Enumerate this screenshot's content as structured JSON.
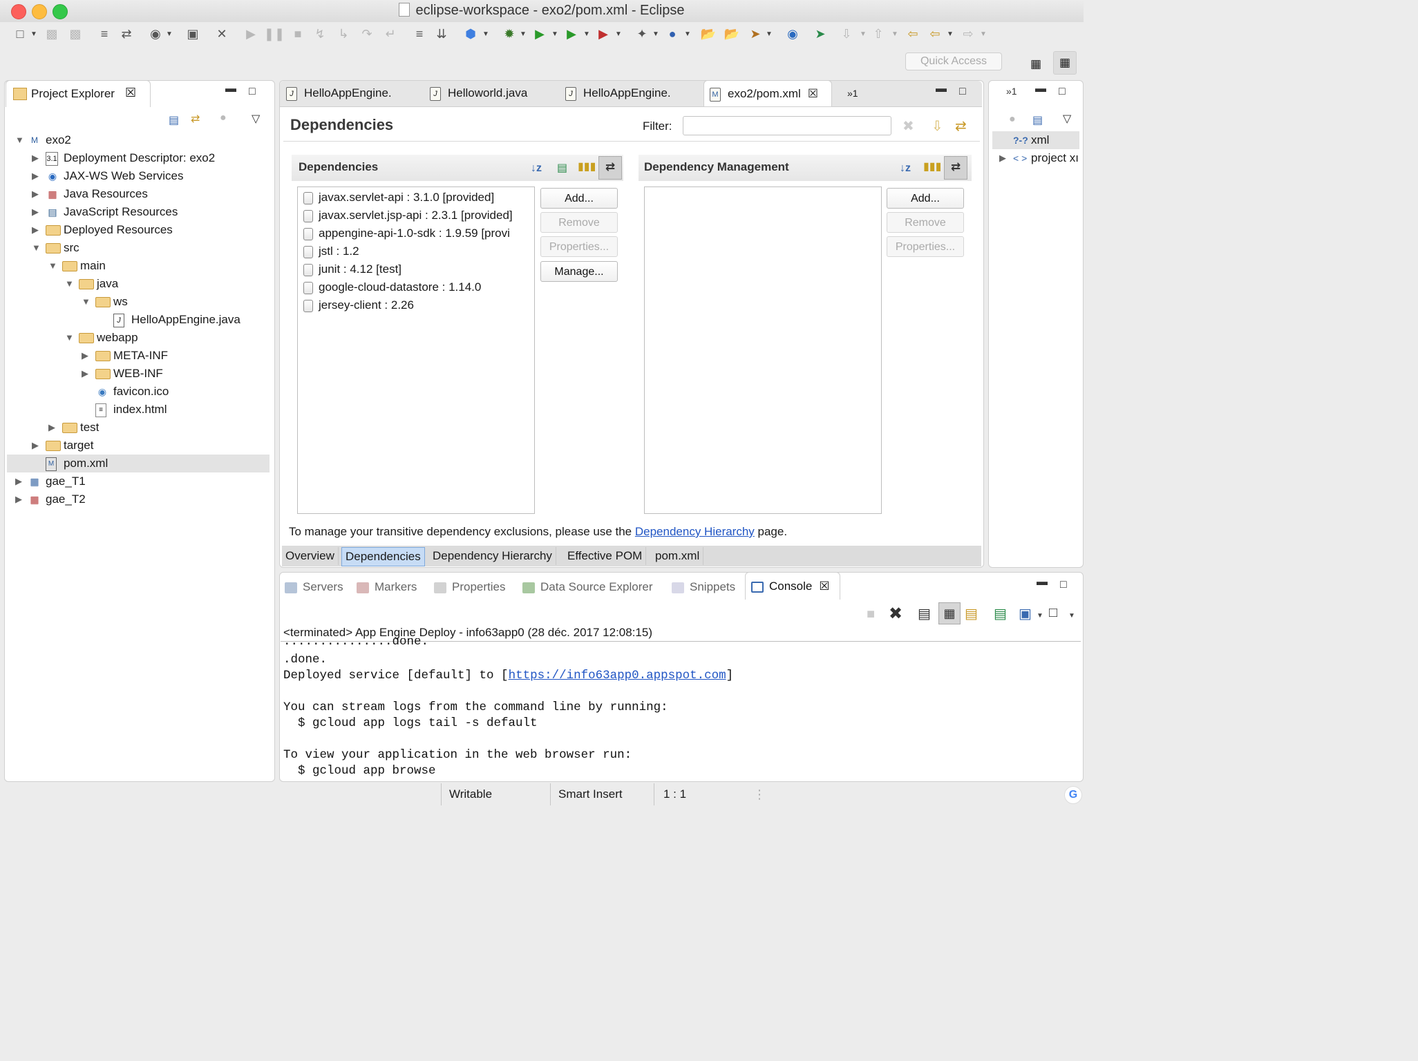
{
  "window": {
    "title": "eclipse-workspace - exo2/pom.xml - Eclipse",
    "colors": {
      "close": "#fc605b",
      "minimize": "#fdbc40",
      "zoom": "#34c84a"
    }
  },
  "toolbar": {
    "quick_access_placeholder": "Quick Access"
  },
  "project_explorer": {
    "tab_label": "Project Explorer",
    "tree": [
      {
        "label": "exo2",
        "icon": "maven-project-icon",
        "expanded": true
      },
      {
        "label": "Deployment Descriptor: exo2",
        "icon": "deployment-descriptor-icon"
      },
      {
        "label": "JAX-WS Web Services",
        "icon": "web-services-icon"
      },
      {
        "label": "Java Resources",
        "icon": "java-resources-icon"
      },
      {
        "label": "JavaScript Resources",
        "icon": "javascript-resources-icon"
      },
      {
        "label": "Deployed Resources",
        "icon": "folder-icon"
      },
      {
        "label": "src",
        "icon": "folder-icon",
        "expanded": true
      },
      {
        "label": "main",
        "icon": "folder-icon",
        "expanded": true
      },
      {
        "label": "java",
        "icon": "folder-icon",
        "expanded": true
      },
      {
        "label": "ws",
        "icon": "folder-icon",
        "expanded": true
      },
      {
        "label": "HelloAppEngine.java",
        "icon": "java-file-icon"
      },
      {
        "label": "webapp",
        "icon": "folder-icon",
        "expanded": true
      },
      {
        "label": "META-INF",
        "icon": "folder-icon"
      },
      {
        "label": "WEB-INF",
        "icon": "folder-icon"
      },
      {
        "label": "favicon.ico",
        "icon": "globe-icon"
      },
      {
        "label": "index.html",
        "icon": "html-file-icon"
      },
      {
        "label": "test",
        "icon": "folder-icon"
      },
      {
        "label": "target",
        "icon": "folder-icon"
      },
      {
        "label": "pom.xml",
        "icon": "pom-file-icon",
        "selected": true
      },
      {
        "label": "gae_T1",
        "icon": "java-project-icon"
      },
      {
        "label": "gae_T2",
        "icon": "java-project-icon"
      }
    ]
  },
  "editor": {
    "tabs": [
      {
        "label": "HelloAppEngine.",
        "icon": "java-file-icon"
      },
      {
        "label": "Helloworld.java",
        "icon": "java-file-icon"
      },
      {
        "label": "HelloAppEngine.",
        "icon": "java-file-icon"
      },
      {
        "label": "exo2/pom.xml",
        "icon": "pom-file-icon",
        "active": true
      }
    ],
    "overflow_label": "»1",
    "page_title": "Dependencies",
    "filter_label": "Filter:",
    "filter_value": "",
    "dependencies": {
      "header": "Dependencies",
      "items": [
        "javax.servlet-api : 3.1.0 [provided]",
        "javax.servlet.jsp-api : 2.3.1 [provided]",
        "appengine-api-1.0-sdk : 1.9.59 [provi",
        "jstl : 1.2",
        "junit : 4.12 [test]",
        "google-cloud-datastore : 1.14.0",
        "jersey-client : 2.26"
      ],
      "buttons": {
        "add": "Add...",
        "remove": "Remove",
        "properties": "Properties...",
        "manage": "Manage..."
      }
    },
    "dependency_management": {
      "header": "Dependency Management",
      "items": [],
      "buttons": {
        "add": "Add...",
        "remove": "Remove",
        "properties": "Properties..."
      }
    },
    "footer": {
      "prefix": "To manage your transitive dependency exclusions, please use the ",
      "link": "Dependency Hierarchy",
      "suffix": " page."
    },
    "page_tabs": [
      {
        "label": "Overview"
      },
      {
        "label": "Dependencies",
        "selected": true
      },
      {
        "label": "Dependency Hierarchy"
      },
      {
        "label": "Effective POM"
      },
      {
        "label": "pom.xml"
      }
    ]
  },
  "outline": {
    "overflow_label": "»1",
    "items": [
      {
        "label": "xml",
        "icon": "xml-declaration-icon"
      },
      {
        "label": "project xı",
        "icon": "element-icon"
      }
    ]
  },
  "bottom_views": {
    "tabs": [
      {
        "label": "Servers"
      },
      {
        "label": "Markers"
      },
      {
        "label": "Properties"
      },
      {
        "label": "Data Source Explorer"
      },
      {
        "label": "Snippets"
      },
      {
        "label": "Console",
        "active": true
      }
    ],
    "console": {
      "header": "<terminated> App Engine Deploy - info63app0 (28 déc. 2017 12:08:15)",
      "lines": [
        "...............done.",
        ".done.",
        "Deployed service [default] to [",
        "https://info63app0.appspot.com",
        "]",
        "",
        "You can stream logs from the command line by running:",
        "  $ gcloud app logs tail -s default",
        "",
        "To view your application in the web browser run:",
        "  $ gcloud app browse"
      ]
    }
  },
  "status_bar": {
    "writable": "Writable",
    "insert_mode": "Smart Insert",
    "position": "1 : 1"
  }
}
